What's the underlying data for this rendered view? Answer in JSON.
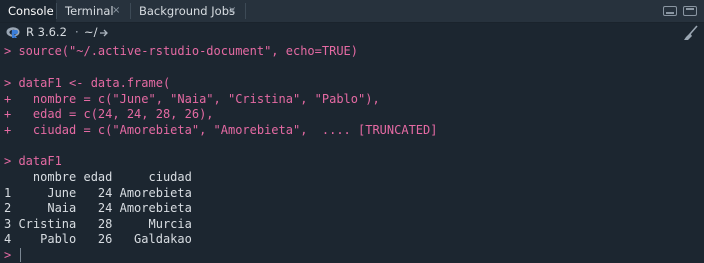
{
  "tabs": [
    {
      "label": "Console",
      "active": true,
      "closable": false
    },
    {
      "label": "Terminal",
      "active": false,
      "closable": true
    },
    {
      "label": "Background Jobs",
      "active": false,
      "closable": true
    }
  ],
  "tab_close_glyph": "×",
  "path_bar": {
    "r_version": "R 3.6.2",
    "separator": "·",
    "working_dir": "~/",
    "logo_icon": "r-logo-icon",
    "goto_icon": "arrow-right-icon",
    "clear_icon": "broom-icon"
  },
  "console": {
    "lines": [
      {
        "text": "> source(\"~/.active-rstudio-document\", echo=TRUE)",
        "kind": "cmd"
      },
      {
        "text": "",
        "kind": "out"
      },
      {
        "text": "> dataF1 <- data.frame(",
        "kind": "cmd"
      },
      {
        "text": "+   nombre = c(\"June\", \"Naia\", \"Cristina\", \"Pablo\"),",
        "kind": "cmd"
      },
      {
        "text": "+   edad = c(24, 24, 28, 26),",
        "kind": "cmd"
      },
      {
        "text": "+   ciudad = c(\"Amorebieta\", \"Amorebieta\",  .... [TRUNCATED]",
        "kind": "cmd"
      },
      {
        "text": "",
        "kind": "out"
      },
      {
        "text": "> dataF1",
        "kind": "cmd"
      },
      {
        "text": "    nombre edad     ciudad",
        "kind": "out"
      },
      {
        "text": "1     June   24 Amorebieta",
        "kind": "out"
      },
      {
        "text": "2     Naia   24 Amorebieta",
        "kind": "out"
      },
      {
        "text": "3 Cristina   28     Murcia",
        "kind": "out"
      },
      {
        "text": "4    Pablo   26   Galdakao",
        "kind": "out"
      }
    ],
    "prompt": ">"
  },
  "colors": {
    "background": "#1c2630",
    "command_text": "#e56aa3",
    "output_text": "#d8dde2"
  }
}
